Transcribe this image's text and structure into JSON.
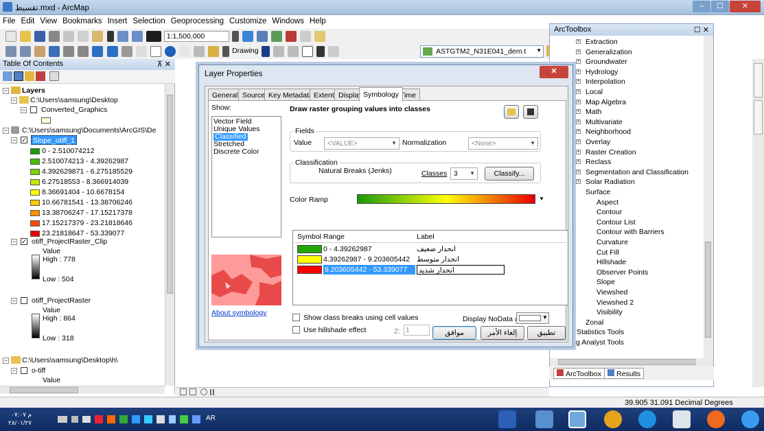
{
  "window": {
    "title": "تقسيط.mxd - ArcMap",
    "min": "–",
    "max": "☐",
    "close": "✕"
  },
  "menu": [
    "File",
    "Edit",
    "View",
    "Bookmarks",
    "Insert",
    "Selection",
    "Geoprocessing",
    "Customize",
    "Windows",
    "Help"
  ],
  "toolbar": {
    "scale": "1:1,500,000",
    "drawing_label": "Drawing",
    "layer_select": "ASTGTM2_N31E041_dem.t"
  },
  "toc": {
    "title": "Table Of Contents",
    "pin": "⊼ ✕",
    "items": {
      "layers": "Layers",
      "desktop_path": "C:\\Users\\samsung\\Desktop",
      "converted_graphics": "Converted_Graphics",
      "arcgis_path": "C:\\Users\\samsung\\Documents\\ArcGIS\\De",
      "slope_layer": "Slope_otiff_1",
      "cls1": "0 - 2.510074212",
      "cls2": "2.510074213 - 4.39262987",
      "cls3": "4.392629871 - 6.275185529",
      "cls4": "6.27518553 - 8.366914039",
      "cls5": "8.36691404 - 10.6678154",
      "cls6": "10.66781541 - 13.38706246",
      "cls7": "13.38706247 - 17.15217378",
      "cls8": "17.15217379 - 23.21818646",
      "cls9": "23.21818647 - 53.339077",
      "clip_layer": "otiff_ProjectRaster_Clip",
      "value1": "Value",
      "high1": "High : 778",
      "low1": "Low : 504",
      "proj_layer": "otiff_ProjectRaster",
      "value2": "Value",
      "high2": "High : 864",
      "low2": "Low : 318",
      "h_path": "C:\\Users\\samsung\\Desktop\\h\\",
      "otiff": "o-tiff",
      "value3": "Value"
    }
  },
  "colors": {
    "cls1": "#1a9a08",
    "cls2": "#44bb00",
    "cls3": "#7dd000",
    "cls4": "#c6e600",
    "cls5": "#ffff00",
    "cls6": "#ffc800",
    "cls7": "#ff9000",
    "cls8": "#ff4a00",
    "cls9": "#e80000"
  },
  "arctoolbox": {
    "title": "ArcToolbox",
    "items": [
      "Extraction",
      "Generalization",
      "Groundwater",
      "Hydrology",
      "Interpolation",
      "Local",
      "Map Algebra",
      "Math",
      "Multivariate",
      "Neighborhood",
      "Overlay",
      "Raster Creation",
      "Reclass",
      "Segmentation and Classification",
      "Solar Radiation",
      "Surface"
    ],
    "surface_items": [
      "Aspect",
      "Contour",
      "Contour List",
      "Contour with Barriers",
      "Curvature",
      "Cut Fill",
      "Hillshade",
      "Observer Points",
      "Slope",
      "Viewshed",
      "Viewshed 2",
      "Visibility"
    ],
    "tail_items": [
      "Zonal",
      "Spatial Statistics Tools",
      "Tracking Analyst Tools"
    ],
    "tab_toolbox": "ArcToolbox",
    "tab_results": "Results"
  },
  "status": {
    "coords": "39.905  31.091 Decimal Degrees"
  },
  "taskbar": {
    "time": "م ٠٧:٠٧",
    "date": "٢٨/٠١/٢٧",
    "lang": "AR"
  },
  "dialog": {
    "title": "Layer Properties",
    "close": "✕",
    "tabs": [
      "General",
      "Source",
      "Key Metadata",
      "Extent",
      "Display",
      "Symbology",
      "Time"
    ],
    "show_label": "Show:",
    "show_items": [
      "Vector Field",
      "Unique Values",
      "Classified",
      "Stretched",
      "Discrete Color"
    ],
    "heading": "Draw raster grouping values into classes",
    "fields_label": "Fields",
    "value_label": "Value",
    "value_combo": "<VALUE>",
    "normalization_label": "Normalization",
    "norm_combo": "<None>",
    "classification_label": "Classification",
    "method": "Natural Breaks (Jenks)",
    "classes_label": "Classes",
    "classes_value": "3",
    "classify_btn": "Classify...",
    "color_ramp_label": "Color Ramp",
    "col_symbol": "Symbol",
    "col_range": "Range",
    "col_label": "Label",
    "rows": [
      {
        "range": "0 - 4.39262987",
        "label": "انحدار ضعيف",
        "color": "#22a800"
      },
      {
        "range": "4.39262987 - 9.203605442",
        "label": "انحدار متوسط",
        "color": "#ffff00"
      },
      {
        "range": "9.203605442 - 53.339077",
        "label": "انحدار شديد",
        "color": "#ff0000"
      }
    ],
    "show_breaks": "Show class breaks using cell values",
    "hillshade": "Use hillshade effect",
    "z_label": "Z:",
    "z_value": "1",
    "nodata_label": "Display NoData as",
    "about": "About symbology",
    "ok": "موافق",
    "cancel": "إلغاء الأمر",
    "apply": "تطبيق"
  }
}
